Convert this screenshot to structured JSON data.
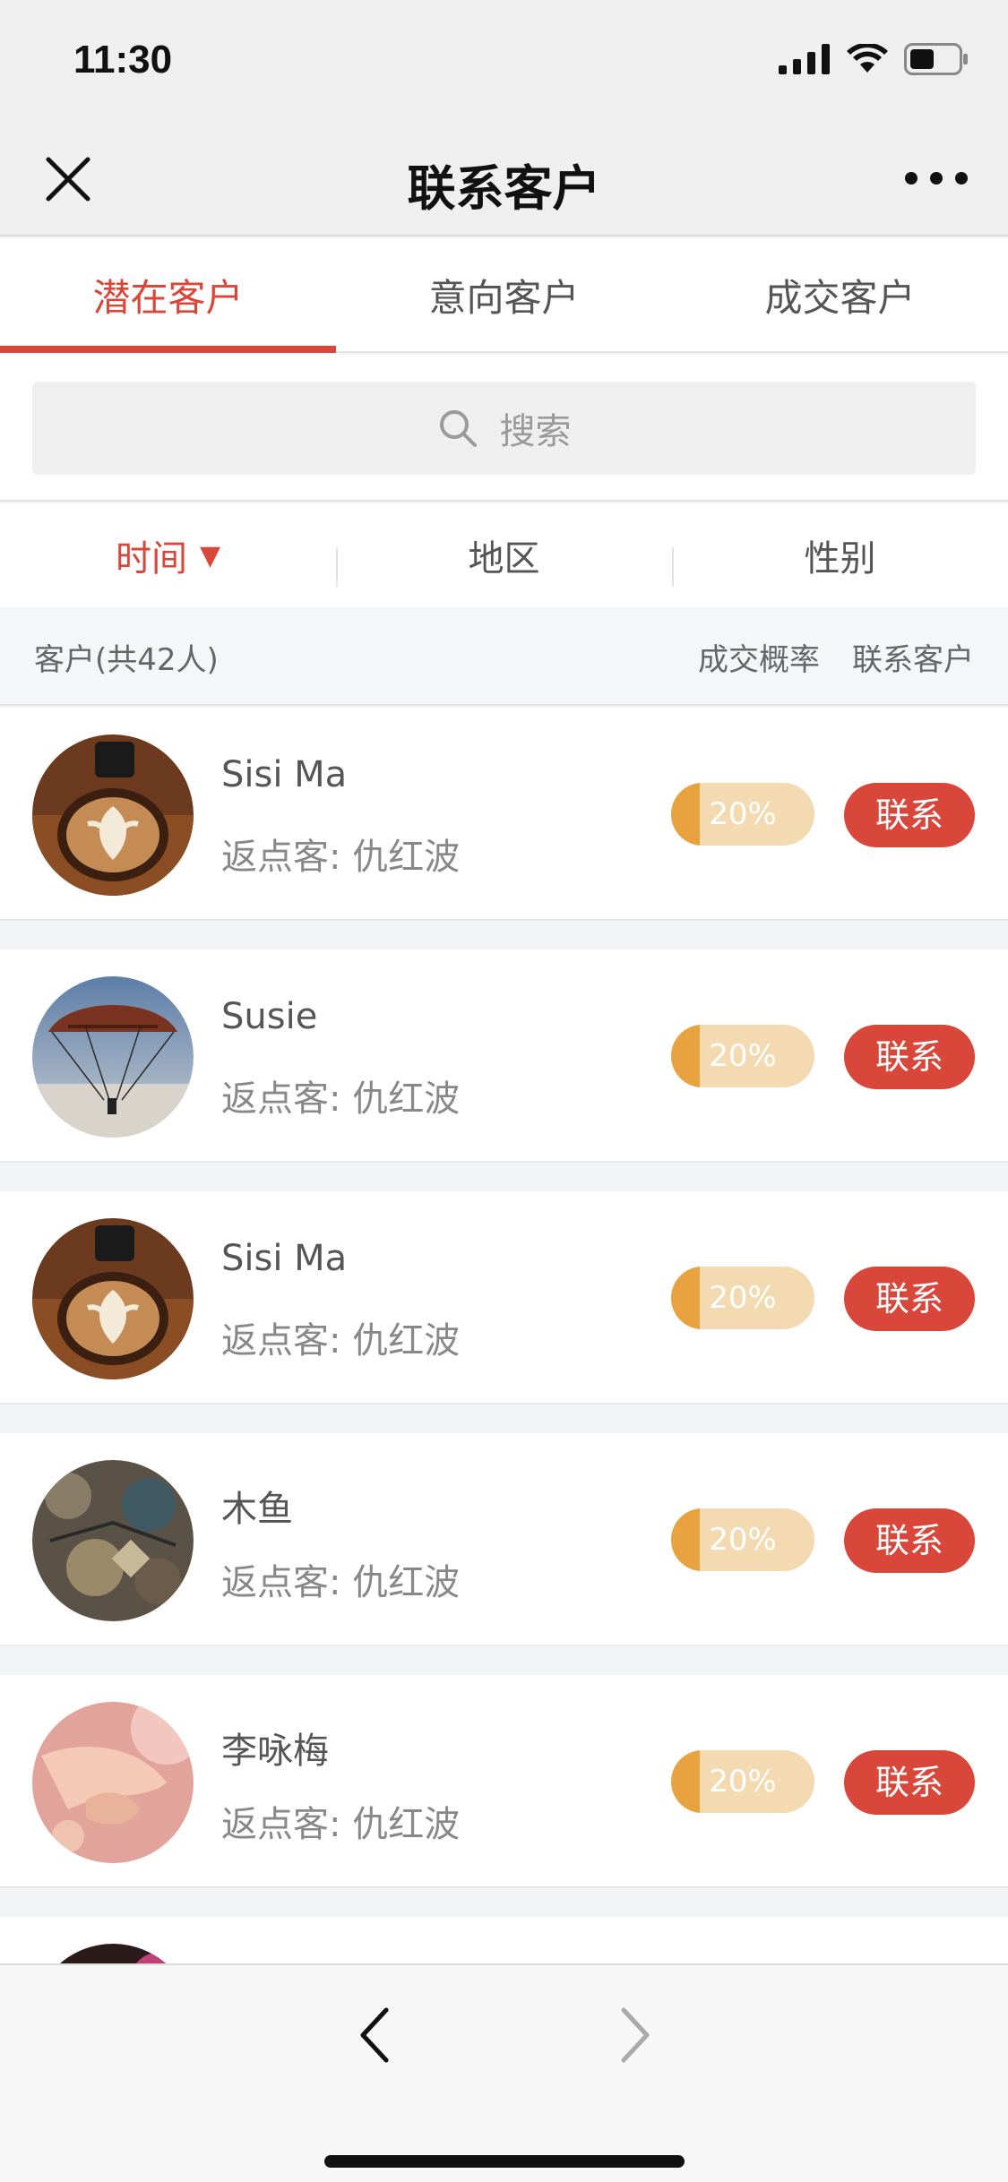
{
  "status_bar": {
    "time": "11:30"
  },
  "nav": {
    "title": "联系客户"
  },
  "tabs": [
    {
      "label": "潜在客户",
      "active": true
    },
    {
      "label": "意向客户",
      "active": false
    },
    {
      "label": "成交客户",
      "active": false
    }
  ],
  "search": {
    "placeholder": "搜索"
  },
  "filters": [
    {
      "label": "时间",
      "active": true,
      "caret": "▼"
    },
    {
      "label": "地区",
      "active": false
    },
    {
      "label": "性别",
      "active": false
    }
  ],
  "list_header": {
    "count": "客户(共42人)",
    "rate_col": "成交概率",
    "contact_col": "联系客户"
  },
  "customers": [
    {
      "name": "Sisi Ma",
      "referrer": "返点客: 仇红波",
      "rate": "20%",
      "rate_value": 0.2,
      "contact": "联系",
      "avatar": "coffee-avatar"
    },
    {
      "name": "Susie",
      "referrer": "返点客: 仇红波",
      "rate": "20%",
      "rate_value": 0.2,
      "contact": "联系",
      "avatar": "parachute-avatar"
    },
    {
      "name": "Sisi Ma",
      "referrer": "返点客: 仇红波",
      "rate": "20%",
      "rate_value": 0.2,
      "contact": "联系",
      "avatar": "coffee-avatar"
    },
    {
      "name": "木鱼",
      "referrer": "返点客: 仇红波",
      "rate": "20%",
      "rate_value": 0.2,
      "contact": "联系",
      "avatar": "mural-avatar"
    },
    {
      "name": "李咏梅",
      "referrer": "返点客: 仇红波",
      "rate": "20%",
      "rate_value": 0.2,
      "contact": "联系",
      "avatar": "hands-avatar"
    }
  ],
  "colors": {
    "accent": "#d9473a",
    "rate_fill": "#e8a23f",
    "rate_track": "#f3dab1"
  }
}
